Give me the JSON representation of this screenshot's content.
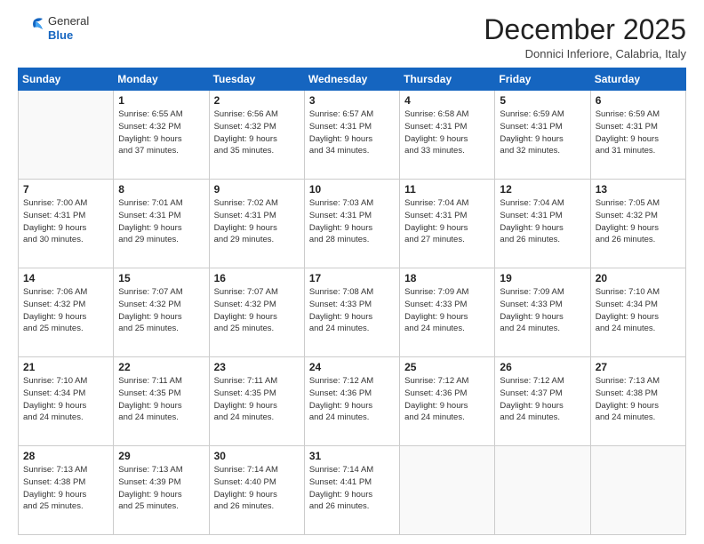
{
  "logo": {
    "general": "General",
    "blue": "Blue"
  },
  "header": {
    "month": "December 2025",
    "location": "Donnici Inferiore, Calabria, Italy"
  },
  "weekdays": [
    "Sunday",
    "Monday",
    "Tuesday",
    "Wednesday",
    "Thursday",
    "Friday",
    "Saturday"
  ],
  "weeks": [
    [
      {
        "day": "",
        "info": ""
      },
      {
        "day": "1",
        "info": "Sunrise: 6:55 AM\nSunset: 4:32 PM\nDaylight: 9 hours\nand 37 minutes."
      },
      {
        "day": "2",
        "info": "Sunrise: 6:56 AM\nSunset: 4:32 PM\nDaylight: 9 hours\nand 35 minutes."
      },
      {
        "day": "3",
        "info": "Sunrise: 6:57 AM\nSunset: 4:31 PM\nDaylight: 9 hours\nand 34 minutes."
      },
      {
        "day": "4",
        "info": "Sunrise: 6:58 AM\nSunset: 4:31 PM\nDaylight: 9 hours\nand 33 minutes."
      },
      {
        "day": "5",
        "info": "Sunrise: 6:59 AM\nSunset: 4:31 PM\nDaylight: 9 hours\nand 32 minutes."
      },
      {
        "day": "6",
        "info": "Sunrise: 6:59 AM\nSunset: 4:31 PM\nDaylight: 9 hours\nand 31 minutes."
      }
    ],
    [
      {
        "day": "7",
        "info": "Sunrise: 7:00 AM\nSunset: 4:31 PM\nDaylight: 9 hours\nand 30 minutes."
      },
      {
        "day": "8",
        "info": "Sunrise: 7:01 AM\nSunset: 4:31 PM\nDaylight: 9 hours\nand 29 minutes."
      },
      {
        "day": "9",
        "info": "Sunrise: 7:02 AM\nSunset: 4:31 PM\nDaylight: 9 hours\nand 29 minutes."
      },
      {
        "day": "10",
        "info": "Sunrise: 7:03 AM\nSunset: 4:31 PM\nDaylight: 9 hours\nand 28 minutes."
      },
      {
        "day": "11",
        "info": "Sunrise: 7:04 AM\nSunset: 4:31 PM\nDaylight: 9 hours\nand 27 minutes."
      },
      {
        "day": "12",
        "info": "Sunrise: 7:04 AM\nSunset: 4:31 PM\nDaylight: 9 hours\nand 26 minutes."
      },
      {
        "day": "13",
        "info": "Sunrise: 7:05 AM\nSunset: 4:32 PM\nDaylight: 9 hours\nand 26 minutes."
      }
    ],
    [
      {
        "day": "14",
        "info": "Sunrise: 7:06 AM\nSunset: 4:32 PM\nDaylight: 9 hours\nand 25 minutes."
      },
      {
        "day": "15",
        "info": "Sunrise: 7:07 AM\nSunset: 4:32 PM\nDaylight: 9 hours\nand 25 minutes."
      },
      {
        "day": "16",
        "info": "Sunrise: 7:07 AM\nSunset: 4:32 PM\nDaylight: 9 hours\nand 25 minutes."
      },
      {
        "day": "17",
        "info": "Sunrise: 7:08 AM\nSunset: 4:33 PM\nDaylight: 9 hours\nand 24 minutes."
      },
      {
        "day": "18",
        "info": "Sunrise: 7:09 AM\nSunset: 4:33 PM\nDaylight: 9 hours\nand 24 minutes."
      },
      {
        "day": "19",
        "info": "Sunrise: 7:09 AM\nSunset: 4:33 PM\nDaylight: 9 hours\nand 24 minutes."
      },
      {
        "day": "20",
        "info": "Sunrise: 7:10 AM\nSunset: 4:34 PM\nDaylight: 9 hours\nand 24 minutes."
      }
    ],
    [
      {
        "day": "21",
        "info": "Sunrise: 7:10 AM\nSunset: 4:34 PM\nDaylight: 9 hours\nand 24 minutes."
      },
      {
        "day": "22",
        "info": "Sunrise: 7:11 AM\nSunset: 4:35 PM\nDaylight: 9 hours\nand 24 minutes."
      },
      {
        "day": "23",
        "info": "Sunrise: 7:11 AM\nSunset: 4:35 PM\nDaylight: 9 hours\nand 24 minutes."
      },
      {
        "day": "24",
        "info": "Sunrise: 7:12 AM\nSunset: 4:36 PM\nDaylight: 9 hours\nand 24 minutes."
      },
      {
        "day": "25",
        "info": "Sunrise: 7:12 AM\nSunset: 4:36 PM\nDaylight: 9 hours\nand 24 minutes."
      },
      {
        "day": "26",
        "info": "Sunrise: 7:12 AM\nSunset: 4:37 PM\nDaylight: 9 hours\nand 24 minutes."
      },
      {
        "day": "27",
        "info": "Sunrise: 7:13 AM\nSunset: 4:38 PM\nDaylight: 9 hours\nand 24 minutes."
      }
    ],
    [
      {
        "day": "28",
        "info": "Sunrise: 7:13 AM\nSunset: 4:38 PM\nDaylight: 9 hours\nand 25 minutes."
      },
      {
        "day": "29",
        "info": "Sunrise: 7:13 AM\nSunset: 4:39 PM\nDaylight: 9 hours\nand 25 minutes."
      },
      {
        "day": "30",
        "info": "Sunrise: 7:14 AM\nSunset: 4:40 PM\nDaylight: 9 hours\nand 26 minutes."
      },
      {
        "day": "31",
        "info": "Sunrise: 7:14 AM\nSunset: 4:41 PM\nDaylight: 9 hours\nand 26 minutes."
      },
      {
        "day": "",
        "info": ""
      },
      {
        "day": "",
        "info": ""
      },
      {
        "day": "",
        "info": ""
      }
    ]
  ]
}
